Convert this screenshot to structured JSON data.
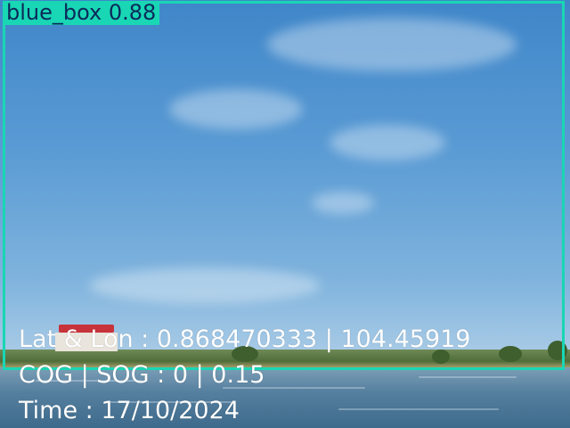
{
  "detection": {
    "label": "blue_box 0.88",
    "box_color": "#19d6b4",
    "label_text_color": "#0b2a5a"
  },
  "telemetry": {
    "latlon": "Lat & Lon : 0.868470333 | 104.45919",
    "cogsog": "COG | SOG : 0 | 0.15",
    "time": "Time : 17/10/2024",
    "text_color": "#ffffff"
  }
}
